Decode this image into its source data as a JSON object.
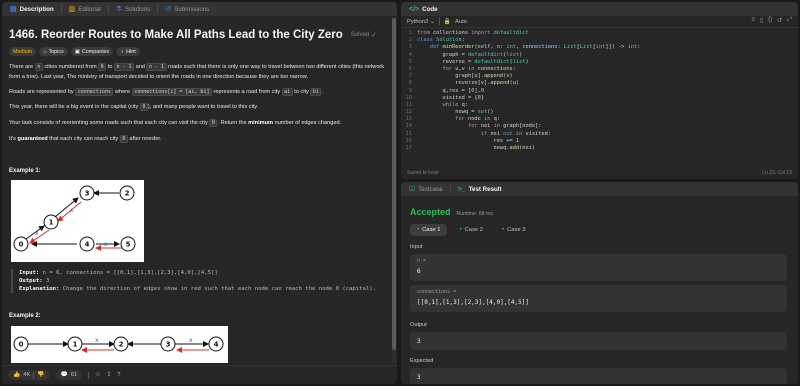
{
  "left_tabs": [
    {
      "label": "Description",
      "icon": "description-icon"
    },
    {
      "label": "Editorial",
      "icon": "editorial-icon"
    },
    {
      "label": "Solutions",
      "icon": "solutions-icon"
    },
    {
      "label": "Submissions",
      "icon": "submissions-icon"
    }
  ],
  "problem": {
    "title": "1466. Reorder Routes to Make All Paths Lead to the City Zero",
    "status": "Solved",
    "badges": [
      "Medium",
      "Topics",
      "Companies",
      "Hint"
    ],
    "p1_a": "There are ",
    "p1_code1": "n",
    "p1_b": " cities numbered from ",
    "p1_code2": "0",
    "p1_c": " to ",
    "p1_code3": "n - 1",
    "p1_d": " and ",
    "p1_code4": "n - 1",
    "p1_e": " roads such that there is only one way to travel between two different cities (this network form a tree). Last year, The ministry of transport decided to orient the roads in one direction because they are too narrow.",
    "p2_a": "Roads are represented by ",
    "p2_code1": "connections",
    "p2_b": " where ",
    "p2_code2": "connections[i] = [ai, bi]",
    "p2_c": " represents a road from city ",
    "p2_code3": "ai",
    "p2_d": " to city ",
    "p2_code4": "bi",
    "p2_e": ".",
    "p3_a": "This year, there will be a big event in the capital (city ",
    "p3_code": "0",
    "p3_b": "), and many people want to travel to this city.",
    "p4_a": "Your task consists of reorienting some roads such that each city can visit the city ",
    "p4_code": "0",
    "p4_b": ". Return the ",
    "p4_bold": "minimum",
    "p4_c": " number of edges changed.",
    "p5_a": "It's ",
    "p5_bold": "guaranteed",
    "p5_b": " that each city can reach city ",
    "p5_code": "0",
    "p5_c": " after reorder."
  },
  "example1": {
    "title": "Example 1:",
    "input_label": "Input:",
    "input_value": "n = 6, connections = [[0,1],[1,3],[2,3],[4,0],[4,5]]",
    "output_label": "Output:",
    "output_value": "3",
    "explanation_label": "Explanation:",
    "explanation_value": "Change the direction of edges show in red such that each node can reach the node 0 (capital).",
    "nodes": [
      "0",
      "1",
      "2",
      "3",
      "4",
      "5"
    ]
  },
  "example2": {
    "title": "Example 2:",
    "nodes": [
      "0",
      "1",
      "2",
      "3",
      "4"
    ]
  },
  "footer": {
    "likes": "4K",
    "comments": "61"
  },
  "code_panel": {
    "tab_label": "Code",
    "language": "Python3",
    "mode": "Auto",
    "saved_text": "Saved to local",
    "cursor_pos": "Ln 23, Col 19"
  },
  "result_panel": {
    "tabs": [
      {
        "label": "Testcase",
        "icon": "testcase-icon"
      },
      {
        "label": "Test Result",
        "icon": "terminal-icon"
      }
    ],
    "verdict": "Accepted",
    "runtime": "Runtime: 68 ms",
    "cases": [
      "Case 1",
      "Case 2",
      "Case 3"
    ],
    "input_label": "Input",
    "n_key": "n =",
    "n_value": "6",
    "conn_key": "connections =",
    "conn_value": "[[0,1],[1,3],[2,3],[4,0],[4,5]]",
    "output_label": "Output",
    "output_value": "3",
    "expected_label": "Expected",
    "expected_value": "3"
  },
  "colors": {
    "accepted": "#2cbb5d",
    "medium": "#ffb800",
    "red_edge": "#d32f2f"
  }
}
